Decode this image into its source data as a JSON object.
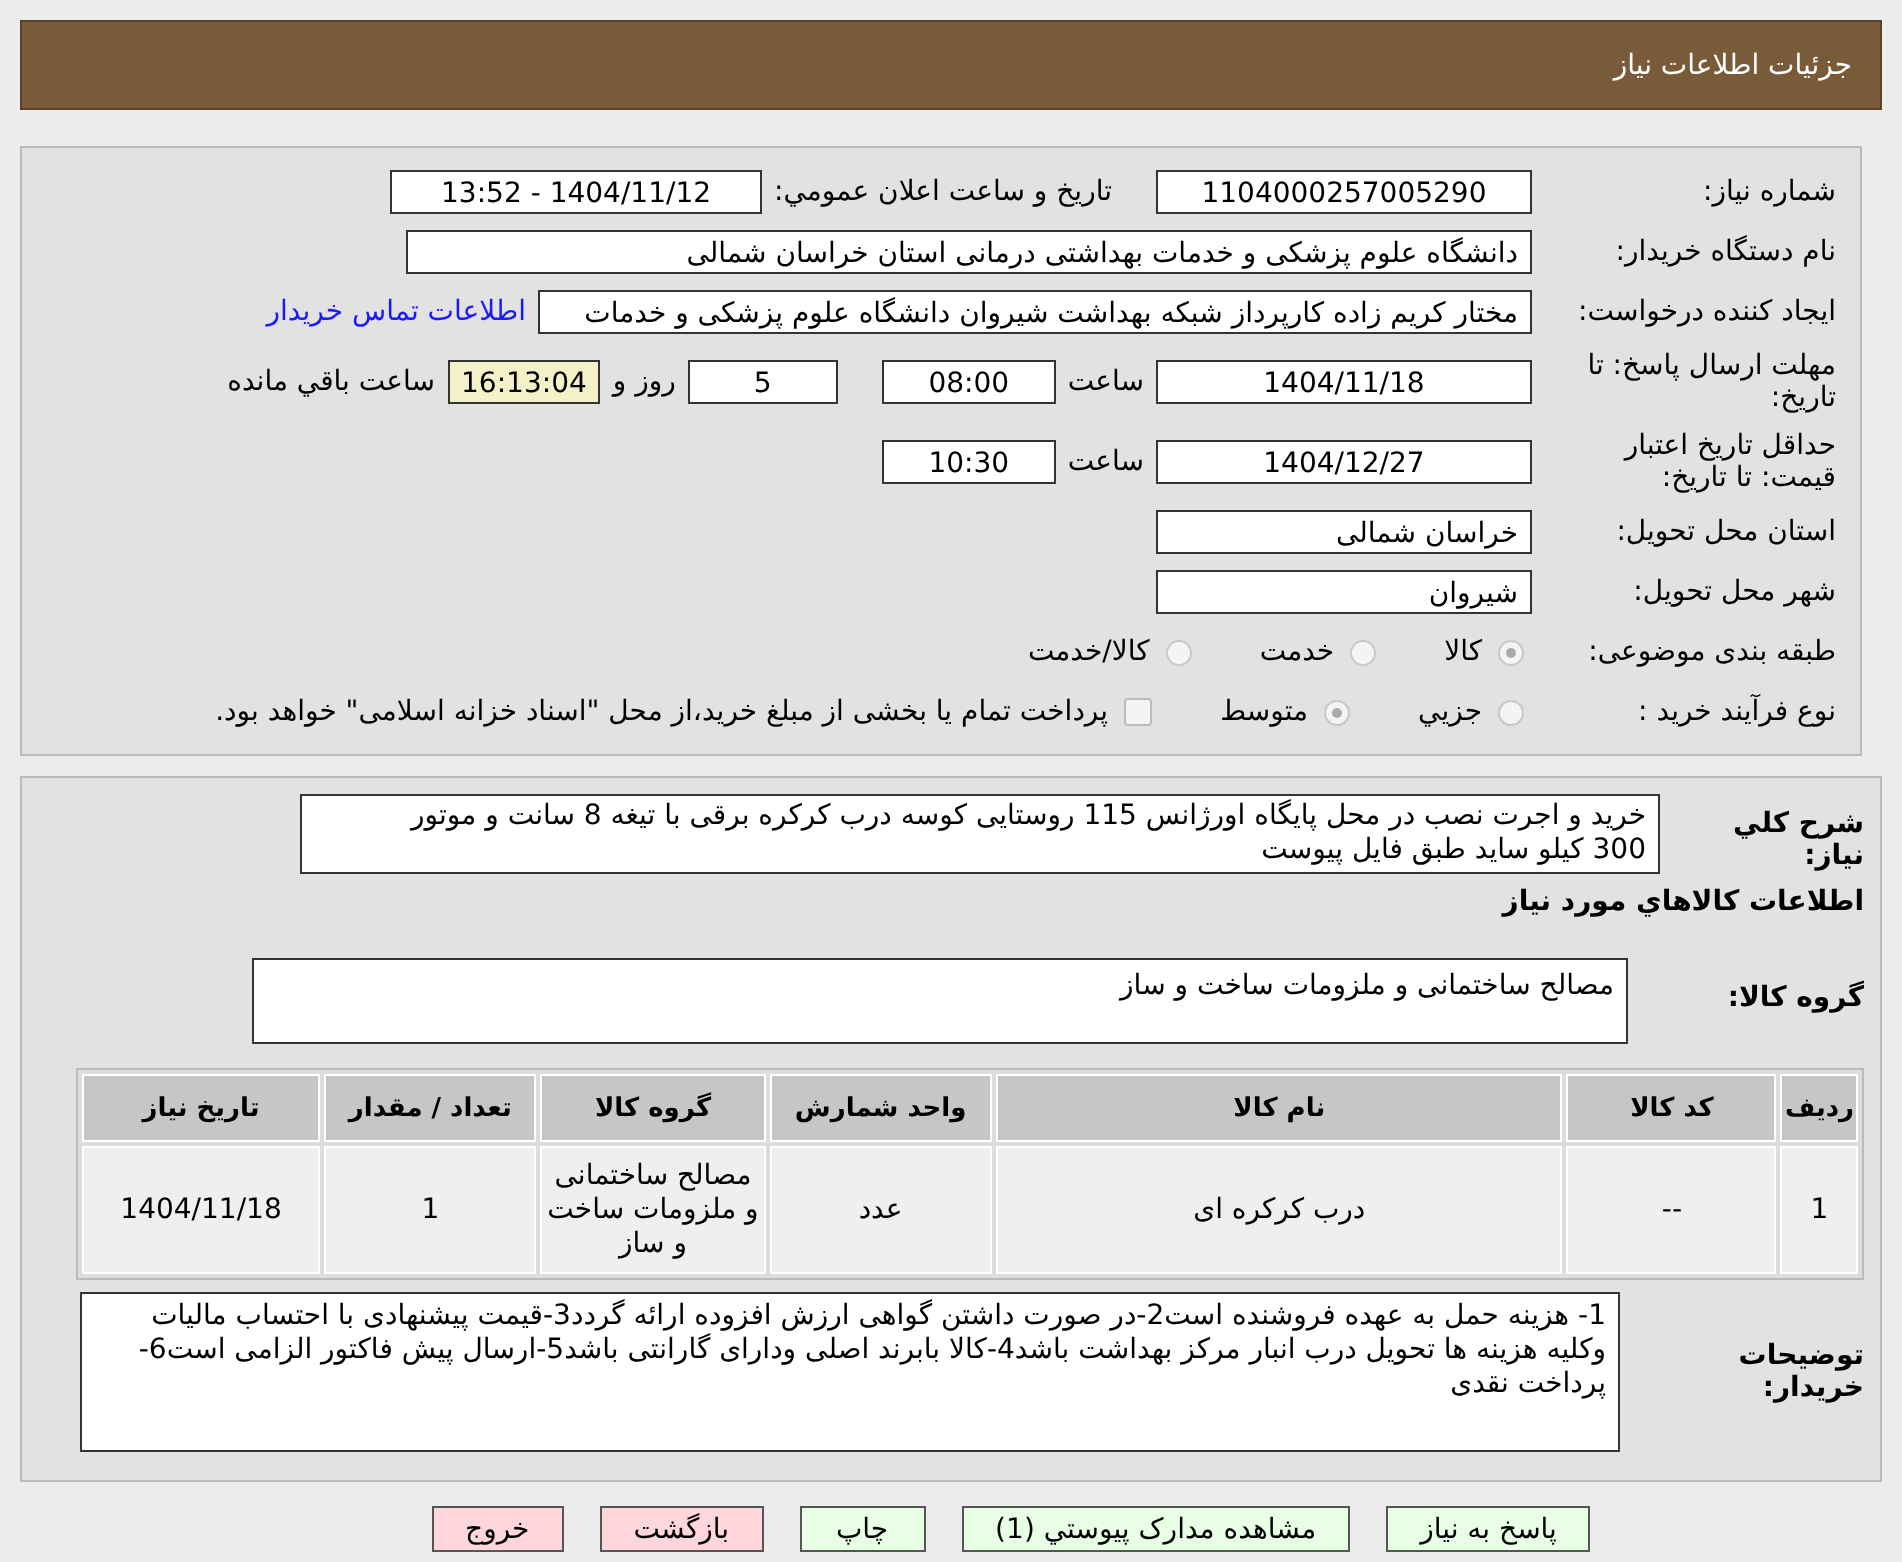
{
  "header": {
    "title": "جزئیات اطلاعات نیاز"
  },
  "need_number": {
    "label": "شماره نیاز:",
    "value": "1104000257005290"
  },
  "announce": {
    "label": "تاریخ و ساعت اعلان عمومي:",
    "value": "1404/11/12 - 13:52"
  },
  "buyer": {
    "label": "نام دستگاه خریدار:",
    "value": "دانشگاه علوم پزشکی و خدمات بهداشتی درمانی استان خراسان شمالی"
  },
  "creator": {
    "label": "ایجاد کننده درخواست:",
    "value": "مختار کریم زاده کارپرداز شبکه بهداشت شیروان دانشگاه علوم پزشکی و خدمات",
    "link": "اطلاعات تماس خریدار"
  },
  "deadline": {
    "label": "مهلت ارسال پاسخ: تا تاریخ:",
    "date": "1404/11/18",
    "time_label": "ساعت",
    "time": "08:00",
    "days": "5",
    "days_label": "روز و",
    "remaining": "16:13:04",
    "remaining_label": "ساعت باقي مانده"
  },
  "validity": {
    "label": "حداقل تاریخ اعتبار قیمت: تا تاریخ:",
    "date": "1404/12/27",
    "time_label": "ساعت",
    "time": "10:30"
  },
  "province": {
    "label": "استان محل تحویل:",
    "value": "خراسان شمالی"
  },
  "city": {
    "label": "شهر محل تحویل:",
    "value": "شیروان"
  },
  "category": {
    "label": "طبقه بندی موضوعی:",
    "options": [
      {
        "label": "کالا",
        "selected": true
      },
      {
        "label": "خدمت",
        "selected": false
      },
      {
        "label": "کالا/خدمت",
        "selected": false
      }
    ]
  },
  "process": {
    "label": "نوع فرآیند خرید :",
    "options": [
      {
        "label": "جزيي",
        "selected": false
      },
      {
        "label": "متوسط",
        "selected": true
      }
    ],
    "payment": {
      "label": "پرداخت تمام یا بخشی از مبلغ خرید،از محل \"اسناد خزانه اسلامی\" خواهد بود.",
      "checked": false
    }
  },
  "description": {
    "label": "شرح کلي نیاز:",
    "value": "خرید و اجرت نصب در محل پایگاه اورژانس 115 روستایی کوسه درب کرکره برقی با تیغه 8 سانت و موتور 300 کیلو ساید طبق فایل پیوست"
  },
  "goods_heading": "اطلاعات کالاهاي مورد نیاز",
  "goods_group": {
    "label": "گروه کالا:",
    "value": "مصالح ساختمانی و ملزومات ساخت و ساز"
  },
  "table": {
    "columns": [
      "ردیف",
      "کد کالا",
      "نام کالا",
      "واحد شمارش",
      "گروه کالا",
      "تعداد / مقدار",
      "تاریخ نیاز"
    ],
    "rows": [
      [
        "1",
        "--",
        "درب کرکره ای",
        "عدد",
        "مصالح ساختمانی و ملزومات ساخت و ساز",
        "1",
        "1404/11/18"
      ]
    ]
  },
  "buyer_notes": {
    "label": "توضیحات خریدار:",
    "value": "1- هزینه حمل به عهده فروشنده است2-در صورت داشتن گواهی ارزش افزوده ارائه گردد3-قیمت پیشنهادی با احتساب مالیات وکلیه هزینه ها تحویل درب انبار مرکز بهداشت  باشد4-کالا بابرند اصلی ودارای گارانتی  باشد5-ارسال پیش فاکتور الزامی است6-پرداخت نقدی"
  },
  "buttons": [
    {
      "label": "پاسخ به نیاز",
      "kind": "action"
    },
    {
      "label": "مشاهده مدارک پیوستي (1)",
      "kind": "action"
    },
    {
      "label": "چاپ",
      "kind": "action"
    },
    {
      "label": "بازگشت",
      "kind": "exit"
    },
    {
      "label": "خروج",
      "kind": "exit"
    }
  ]
}
